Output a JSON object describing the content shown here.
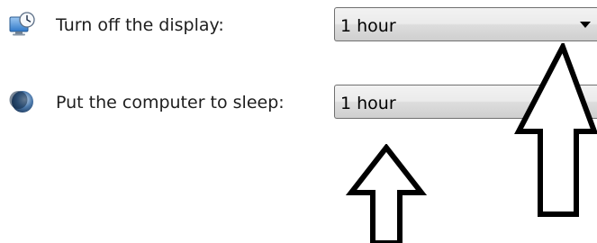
{
  "settings": {
    "display": {
      "label": "Turn off the display:",
      "value": "1 hour",
      "icon": "monitor-clock-icon"
    },
    "sleep": {
      "label": "Put the computer to sleep:",
      "value": "1 hour",
      "icon": "moon-icon"
    }
  },
  "annotations": [
    {
      "icon": "up-arrow-annotation-icon",
      "color": "#000000"
    },
    {
      "icon": "up-arrow-annotation-icon",
      "color": "#000000"
    }
  ],
  "colors": {
    "dropdown_border": "#707070",
    "dropdown_fill": "#ebebeb",
    "text": "#1e1e1e"
  }
}
